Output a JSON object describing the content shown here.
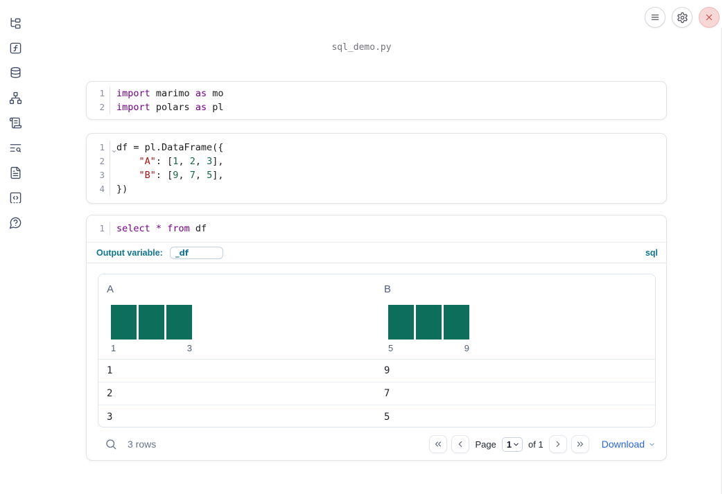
{
  "app": {
    "title": "sql_demo.py"
  },
  "colors": {
    "bar_green": "#0e6e5c",
    "keyword_purple": "#770088",
    "string_red": "#aa1111",
    "number_green": "#116644",
    "accent_teal": "#0e7490",
    "link_blue": "#2563eb",
    "close_red": "#c84848"
  },
  "sidebar": {
    "items": [
      {
        "icon": "file-tree-icon"
      },
      {
        "icon": "function-square-icon"
      },
      {
        "icon": "database-icon"
      },
      {
        "icon": "dependency-graph-icon"
      },
      {
        "icon": "scroll-icon"
      },
      {
        "icon": "list-search-icon"
      },
      {
        "icon": "document-icon"
      },
      {
        "icon": "code-snippet-icon"
      },
      {
        "icon": "help-bubble-icon"
      }
    ]
  },
  "topbar": {
    "buttons": [
      {
        "icon": "menu-icon"
      },
      {
        "icon": "gear-icon"
      },
      {
        "icon": "close-icon"
      }
    ]
  },
  "cells": [
    {
      "lines": [
        {
          "num": "1",
          "tokens": [
            {
              "c": "kw",
              "t": "import"
            },
            {
              "c": "pl",
              "t": " marimo "
            },
            {
              "c": "kw",
              "t": "as"
            },
            {
              "c": "pl",
              "t": " mo"
            }
          ]
        },
        {
          "num": "2",
          "tokens": [
            {
              "c": "kw",
              "t": "import"
            },
            {
              "c": "pl",
              "t": " polars "
            },
            {
              "c": "kw",
              "t": "as"
            },
            {
              "c": "pl",
              "t": " pl"
            }
          ]
        }
      ]
    },
    {
      "lines": [
        {
          "num": "1",
          "fold": true,
          "tokens": [
            {
              "c": "pl",
              "t": "df = pl.DataFrame({"
            }
          ]
        },
        {
          "num": "2",
          "tokens": [
            {
              "c": "pl",
              "t": "    "
            },
            {
              "c": "str",
              "t": "\"A\""
            },
            {
              "c": "pl",
              "t": ": ["
            },
            {
              "c": "num",
              "t": "1"
            },
            {
              "c": "pl",
              "t": ", "
            },
            {
              "c": "num",
              "t": "2"
            },
            {
              "c": "pl",
              "t": ", "
            },
            {
              "c": "num",
              "t": "3"
            },
            {
              "c": "pl",
              "t": "],"
            }
          ]
        },
        {
          "num": "3",
          "tokens": [
            {
              "c": "pl",
              "t": "    "
            },
            {
              "c": "str",
              "t": "\"B\""
            },
            {
              "c": "pl",
              "t": ": ["
            },
            {
              "c": "num",
              "t": "9"
            },
            {
              "c": "pl",
              "t": ", "
            },
            {
              "c": "num",
              "t": "7"
            },
            {
              "c": "pl",
              "t": ", "
            },
            {
              "c": "num",
              "t": "5"
            },
            {
              "c": "pl",
              "t": "],"
            }
          ]
        },
        {
          "num": "4",
          "tokens": [
            {
              "c": "pl",
              "t": "})"
            }
          ]
        }
      ]
    },
    {
      "lines": [
        {
          "num": "1",
          "tokens": [
            {
              "c": "kw",
              "t": "select"
            },
            {
              "c": "pl",
              "t": " "
            },
            {
              "c": "kw",
              "t": "*"
            },
            {
              "c": "pl",
              "t": " "
            },
            {
              "c": "kw",
              "t": "from"
            },
            {
              "c": "pl",
              "t": " df"
            }
          ]
        }
      ]
    }
  ],
  "sql_cell": {
    "output_variable_label": "Output variable:",
    "output_variable_value": "_df",
    "language_badge": "sql"
  },
  "table": {
    "columns": [
      {
        "label": "A",
        "hist_bars": [
          1,
          1,
          1
        ],
        "hist_min": "1",
        "hist_max": "3"
      },
      {
        "label": "B",
        "hist_bars": [
          1,
          1,
          1
        ],
        "hist_min": "5",
        "hist_max": "9"
      }
    ],
    "rows": [
      [
        "1",
        "9"
      ],
      [
        "2",
        "7"
      ],
      [
        "3",
        "5"
      ]
    ],
    "footer": {
      "row_count": "3 rows",
      "page_label": "Page",
      "page_value": "1",
      "page_total_label": "of 1",
      "download_label": "Download"
    }
  }
}
